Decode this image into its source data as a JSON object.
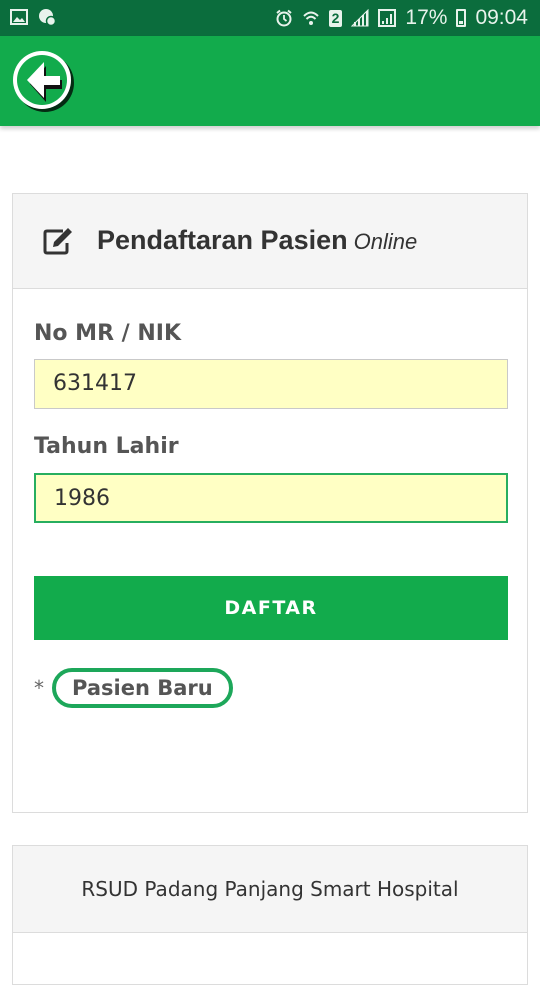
{
  "status_bar": {
    "battery": "17%",
    "time": "09:04",
    "sim_slot": "2",
    "icons": [
      "image-icon",
      "location-icon",
      "alarm-icon",
      "wifi-icon",
      "signal-icon",
      "signal-icon",
      "battery-icon"
    ]
  },
  "app_bar": {
    "back_icon": "back-arrow-icon",
    "color": "#12ab4c"
  },
  "registration": {
    "title": "Pendaftaran Pasien",
    "title_suffix": "Online",
    "edit_icon": "edit-icon",
    "fields": [
      {
        "label": "No MR / NIK",
        "value": "631417"
      },
      {
        "label": "Tahun Lahir",
        "value": "1986"
      }
    ],
    "submit_label": "DAFTAR",
    "new_patient_prefix": "*",
    "new_patient_label": "Pasien Baru"
  },
  "footer_card": {
    "title": "RSUD Padang Panjang Smart Hospital"
  },
  "colors": {
    "status_bar": "#0b6d3d",
    "accent": "#12ab4c",
    "input_bg": "#ffffc4",
    "card_header_bg": "#f5f5f5"
  }
}
